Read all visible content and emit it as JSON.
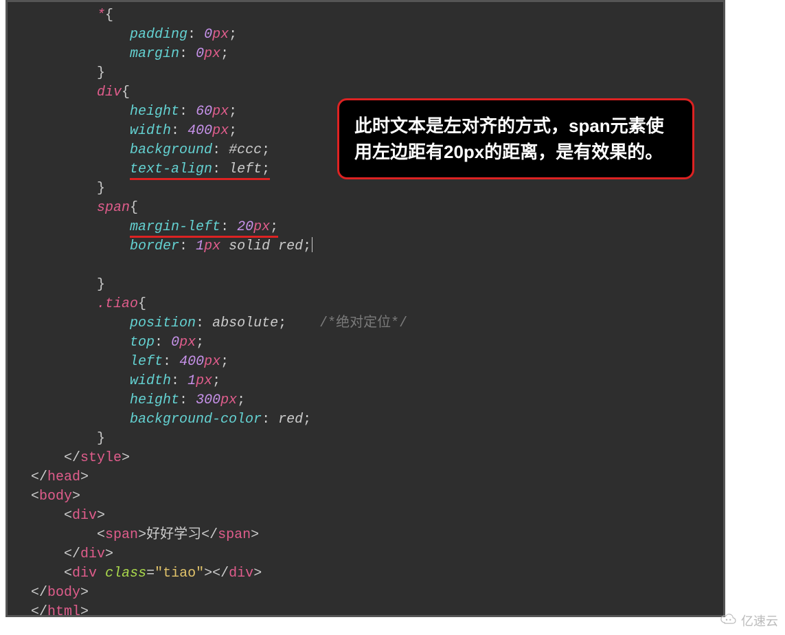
{
  "code": {
    "l1_sel": "*",
    "l1_brace": "{",
    "l2_prop": "padding",
    "l2_colon": ": ",
    "l2_num": "0",
    "l2_unit": "px",
    "l2_semi": ";",
    "l3_prop": "margin",
    "l3_colon": ": ",
    "l3_num": "0",
    "l3_unit": "px",
    "l3_semi": ";",
    "l4_brace": "}",
    "l5_sel": "div",
    "l5_brace": "{",
    "l6_prop": "height",
    "l6_colon": ": ",
    "l6_num": "60",
    "l6_unit": "px",
    "l6_semi": ";",
    "l7_prop": "width",
    "l7_colon": ": ",
    "l7_num": "400",
    "l7_unit": "px",
    "l7_semi": ";",
    "l8_prop": "background",
    "l8_colon": ": ",
    "l8_val": "#ccc",
    "l8_semi": ";",
    "l9_prop": "text-align",
    "l9_colon": ": ",
    "l9_val": "left",
    "l9_semi": ";",
    "l10_brace": "}",
    "l11_sel": "span",
    "l11_brace": "{",
    "l12_prop": "margin-left",
    "l12_colon": ": ",
    "l12_num": "20",
    "l12_unit": "px",
    "l12_semi": ";",
    "l13_prop": "border",
    "l13_colon": ": ",
    "l13_num": "1",
    "l13_unit": "px",
    "l13_val1": " solid ",
    "l13_val2": "red",
    "l13_semi": ";",
    "l15_brace": "}",
    "l16_sel": ".tiao",
    "l16_brace": "{",
    "l17_prop": "position",
    "l17_colon": ": ",
    "l17_val": "absolute",
    "l17_semi": ";",
    "l17_cmt": "/*绝对定位*/",
    "l18_prop": "top",
    "l18_colon": ": ",
    "l18_num": "0",
    "l18_unit": "px",
    "l18_semi": ";",
    "l19_prop": "left",
    "l19_colon": ": ",
    "l19_num": "400",
    "l19_unit": "px",
    "l19_semi": ";",
    "l20_prop": "width",
    "l20_colon": ": ",
    "l20_num": "1",
    "l20_unit": "px",
    "l20_semi": ";",
    "l21_prop": "height",
    "l21_colon": ": ",
    "l21_num": "300",
    "l21_unit": "px",
    "l21_semi": ";",
    "l22_prop": "background-color",
    "l22_colon": ": ",
    "l22_val": "red",
    "l22_semi": ";",
    "l23_brace": "}",
    "l24_open": "</",
    "l24_tag": "style",
    "l24_close": ">",
    "l25_open": "</",
    "l25_tag": "head",
    "l25_close": ">",
    "l26_open": "<",
    "l26_tag": "body",
    "l26_close": ">",
    "l27_open": "<",
    "l27_tag": "div",
    "l27_close": ">",
    "l28_open": "<",
    "l28_tag": "span",
    "l28_close": ">",
    "l28_txt": "好好学习",
    "l28_open2": "</",
    "l28_tag2": "span",
    "l28_close2": ">",
    "l29_open": "</",
    "l29_tag": "div",
    "l29_close": ">",
    "l30_open": "<",
    "l30_tag": "div",
    "l30_sp": " ",
    "l30_attr": "class",
    "l30_eq": "=",
    "l30_q1": "\"",
    "l30_str": "tiao",
    "l30_q2": "\"",
    "l30_close": ">",
    "l30_open2": "</",
    "l30_tag2": "div",
    "l30_close2": ">",
    "l31_open": "</",
    "l31_tag": "body",
    "l31_close": ">",
    "l32_open": "</",
    "l32_tag": "html",
    "l32_close": ">"
  },
  "annotation": {
    "text": "此时文本是左对齐的方式，span元素使用左边距有20px的距离，是有效果的。"
  },
  "watermark": {
    "text": "亿速云"
  }
}
